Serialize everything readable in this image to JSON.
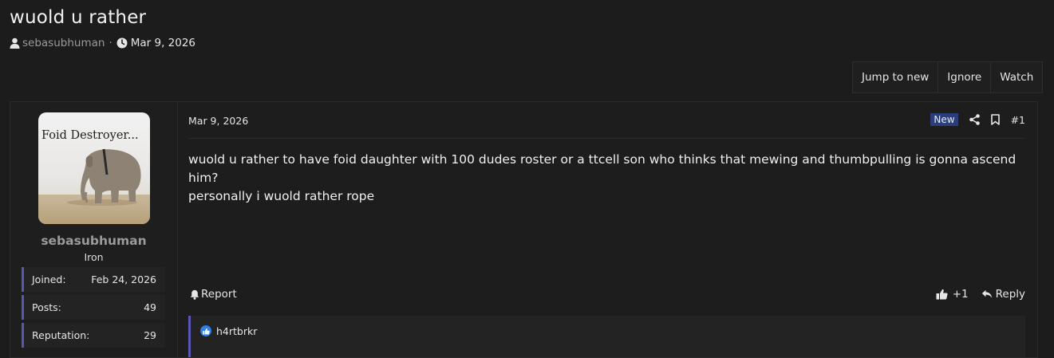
{
  "thread": {
    "title": "wuold u rather",
    "author": "sebasubhuman",
    "separator": "·",
    "date": "Mar 9, 2026"
  },
  "actions": {
    "jump_to_new": "Jump to new",
    "ignore": "Ignore",
    "watch": "Watch"
  },
  "user": {
    "name": "sebasubhuman",
    "rank": "Iron",
    "avatar_text": "Foid Destroyer...",
    "stats": [
      {
        "label": "Joined:",
        "value": "Feb 24, 2026"
      },
      {
        "label": "Posts:",
        "value": "49"
      },
      {
        "label": "Reputation:",
        "value": "29"
      }
    ]
  },
  "post": {
    "date": "Mar 9, 2026",
    "badge": "New",
    "number": "#1",
    "lines": [
      "wuold u rather to have foid daughter with 100 dudes roster or a ttcell son who thinks that mewing and thumbpulling is gonna ascend him?",
      "personally i wuold rather rope"
    ],
    "report_label": "Report",
    "like_count": "+1",
    "reply_label": "Reply",
    "reaction_user": "h4rtbrkr"
  },
  "colors": {
    "background": "#1c1c1c",
    "accent": "#5a57b0",
    "badge": "#2a3f7a",
    "reaction": "#2f7fe6"
  },
  "icons": [
    "user-icon",
    "clock-icon",
    "share-icon",
    "bookmark-icon",
    "bell-icon",
    "thumbs-up-icon",
    "reply-icon",
    "like-reaction-icon"
  ]
}
